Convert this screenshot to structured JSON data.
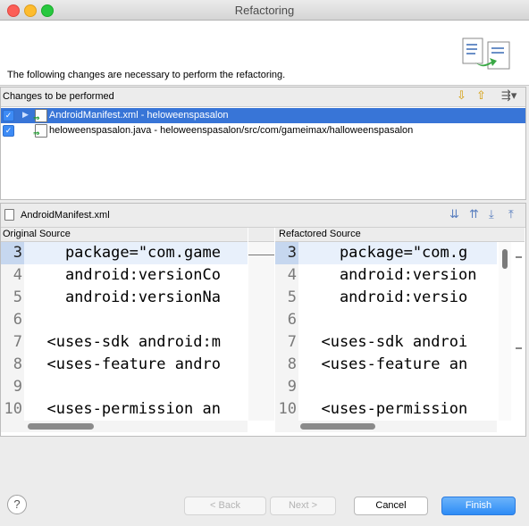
{
  "window": {
    "title": "Refactoring"
  },
  "banner": {
    "message": "The following changes are necessary to perform the refactoring."
  },
  "changes": {
    "label": "Changes to be performed",
    "items": [
      {
        "label": "AndroidManifest.xml - heloweenspasalon",
        "checked": true,
        "selected": true
      },
      {
        "label": "heloweenspasalon.java - heloweenspasalon/src/com/gameimax/halloweenspasalon",
        "checked": true,
        "selected": false
      }
    ],
    "toolbar": {
      "down": "⇩",
      "up": "⇧",
      "filter": "⇶▾"
    }
  },
  "preview": {
    "file": "AndroidManifest.xml",
    "original_label": "Original Source",
    "refactored_label": "Refactored Source",
    "original_lines": [
      {
        "num": "3",
        "text": "    package=\"com.game"
      },
      {
        "num": "4",
        "text": "    android:versionCo"
      },
      {
        "num": "5",
        "text": "    android:versionNa"
      },
      {
        "num": "6",
        "text": ""
      },
      {
        "num": "7",
        "text": "  <uses-sdk android:m"
      },
      {
        "num": "8",
        "text": "  <uses-feature andro"
      },
      {
        "num": "9",
        "text": ""
      },
      {
        "num": "10",
        "text": "  <uses-permission an"
      }
    ],
    "refactored_lines": [
      {
        "num": "3",
        "text": "    package=\"com.g"
      },
      {
        "num": "4",
        "text": "    android:version"
      },
      {
        "num": "5",
        "text": "    android:versio"
      },
      {
        "num": "6",
        "text": ""
      },
      {
        "num": "7",
        "text": "  <uses-sdk androi"
      },
      {
        "num": "8",
        "text": "  <uses-feature an"
      },
      {
        "num": "9",
        "text": ""
      },
      {
        "num": "10",
        "text": "  <uses-permission"
      }
    ]
  },
  "buttons": {
    "help": "?",
    "back": "< Back",
    "next": "Next >",
    "cancel": "Cancel",
    "finish": "Finish"
  },
  "colors": {
    "selection": "#3875d7",
    "primary": "#2d8cf6"
  }
}
